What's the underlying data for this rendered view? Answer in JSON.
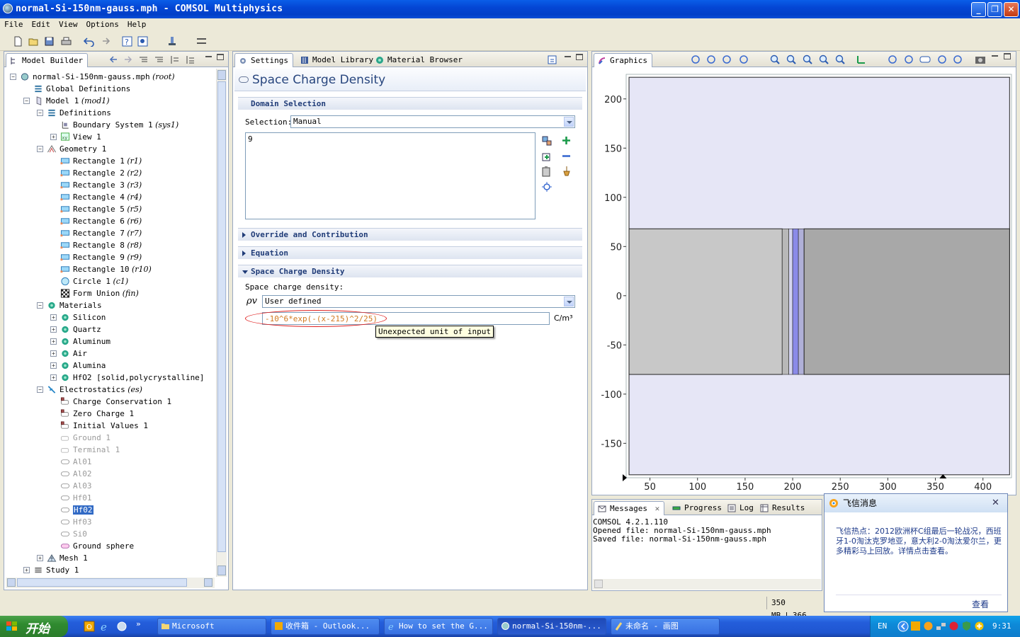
{
  "window": {
    "title": "normal-Si-150nm-gauss.mph - COMSOL Multiphysics"
  },
  "menu": [
    "File",
    "Edit",
    "View",
    "Options",
    "Help"
  ],
  "model_builder": {
    "tab": "Model Builder",
    "tree": [
      {
        "label": "normal-Si-150nm-gauss.mph",
        "tag": "(root)"
      },
      {
        "label": "Global Definitions",
        "tag": ""
      },
      {
        "label": "Model 1",
        "tag": "(mod1)"
      },
      {
        "label": "Definitions",
        "tag": ""
      },
      {
        "label": "Boundary System 1",
        "tag": "(sys1)"
      },
      {
        "label": "View 1",
        "tag": ""
      },
      {
        "label": "Geometry 1",
        "tag": ""
      },
      {
        "label": "Rectangle 1",
        "tag": "(r1)"
      },
      {
        "label": "Rectangle 2",
        "tag": "(r2)"
      },
      {
        "label": "Rectangle 3",
        "tag": "(r3)"
      },
      {
        "label": "Rectangle 4",
        "tag": "(r4)"
      },
      {
        "label": "Rectangle 5",
        "tag": "(r5)"
      },
      {
        "label": "Rectangle 6",
        "tag": "(r6)"
      },
      {
        "label": "Rectangle 7",
        "tag": "(r7)"
      },
      {
        "label": "Rectangle 8",
        "tag": "(r8)"
      },
      {
        "label": "Rectangle 9",
        "tag": "(r9)"
      },
      {
        "label": "Rectangle 10",
        "tag": "(r10)"
      },
      {
        "label": "Circle 1",
        "tag": "(c1)"
      },
      {
        "label": "Form Union",
        "tag": "(fin)"
      },
      {
        "label": "Materials",
        "tag": ""
      },
      {
        "label": "Silicon",
        "tag": ""
      },
      {
        "label": "Quartz",
        "tag": ""
      },
      {
        "label": "Aluminum",
        "tag": ""
      },
      {
        "label": "Air",
        "tag": ""
      },
      {
        "label": "Alumina",
        "tag": ""
      },
      {
        "label": "HfO2 [solid,polycrystalline]",
        "tag": ""
      },
      {
        "label": "Electrostatics",
        "tag": "(es)"
      },
      {
        "label": "Charge Conservation 1",
        "tag": ""
      },
      {
        "label": "Zero Charge 1",
        "tag": ""
      },
      {
        "label": "Initial Values 1",
        "tag": ""
      },
      {
        "label": "Ground 1",
        "tag": ""
      },
      {
        "label": "Terminal 1",
        "tag": ""
      },
      {
        "label": "Al01",
        "tag": ""
      },
      {
        "label": "Al02",
        "tag": ""
      },
      {
        "label": "Al03",
        "tag": ""
      },
      {
        "label": "Hf01",
        "tag": ""
      },
      {
        "label": "Hf02",
        "tag": ""
      },
      {
        "label": "Hf03",
        "tag": ""
      },
      {
        "label": "Si0",
        "tag": ""
      },
      {
        "label": "Ground sphere",
        "tag": ""
      },
      {
        "label": "Mesh 1",
        "tag": ""
      },
      {
        "label": "Study 1",
        "tag": ""
      }
    ]
  },
  "settings": {
    "tabs": [
      "Settings",
      "Model Library",
      "Material Browser"
    ],
    "title": "Space Charge Density",
    "domain_selection": {
      "header": "Domain Selection",
      "selection_label": "Selection:",
      "selection_value": "Manual",
      "list_value": "9"
    },
    "override_header": "Override and Contribution",
    "equation_header": "Equation",
    "scd": {
      "header": "Space Charge Density",
      "label": "Space charge density:",
      "symbol": "ρv",
      "combo": "User defined",
      "expression": "-10^6*exp(-(x-215)^2/25)",
      "unit": "C/m³",
      "tooltip": "Unexpected unit of input"
    }
  },
  "graphics": {
    "tab": "Graphics",
    "colors": {
      "air": "#e6e6f6",
      "silicon": "#c8c8c8",
      "quartz": "#a8a8a8",
      "hfo2": "#8a8ae8"
    }
  },
  "chart_data": {
    "type": "geometry",
    "xlim": [
      25,
      430
    ],
    "ylim": [
      -185,
      225
    ],
    "xticks": [
      50,
      100,
      150,
      200,
      250,
      300,
      350,
      400
    ],
    "yticks": [
      200,
      150,
      100,
      50,
      0,
      -50,
      -100,
      -150
    ]
  },
  "messages": {
    "tabs": [
      "Messages",
      "Progress",
      "Log",
      "Results"
    ],
    "lines": [
      "COMSOL 4.2.1.110",
      "Opened file: normal-Si-150nm-gauss.mph",
      "Saved file: normal-Si-150nm-gauss.mph"
    ]
  },
  "status": {
    "memory1": "350 MB",
    "memory2": "366"
  },
  "popup": {
    "title": "飞信消息",
    "body": "飞信热点：2012欧洲杯C组最后一轮战况，西班牙1-0淘汰克罗地亚，意大利2-0淘汰爱尔兰，更多精彩马上回放。详情点击查看。",
    "link": "查看"
  },
  "taskbar": {
    "start": "开始",
    "tasks": [
      "Microsoft",
      "收件箱 - Outlook...",
      "How to set the G...",
      "normal-Si-150nm-...",
      "未命名 - 画图"
    ],
    "lang": "EN",
    "clock": "9:31"
  }
}
